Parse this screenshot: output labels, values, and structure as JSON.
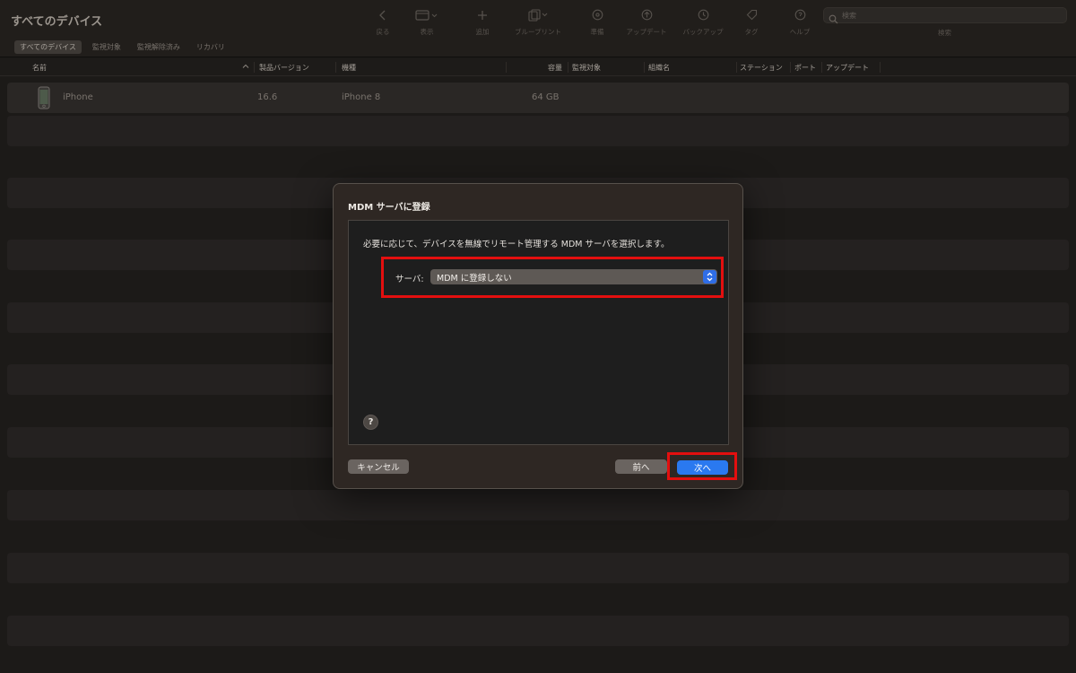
{
  "window": {
    "title": "すべてのデバイス"
  },
  "filter_tabs": [
    {
      "label": "すべてのデバイス",
      "active": true
    },
    {
      "label": "監視対象",
      "active": false
    },
    {
      "label": "監視解除済み",
      "active": false
    },
    {
      "label": "リカバリ",
      "active": false
    }
  ],
  "toolbar": {
    "buttons": [
      {
        "label": "戻る",
        "icon": "chevron-left-icon"
      },
      {
        "label": "表示",
        "icon": "view-icon"
      },
      {
        "label": "追加",
        "icon": "plus-icon"
      },
      {
        "label": "ブループリント",
        "icon": "blueprint-icon"
      },
      {
        "label": "準備",
        "icon": "prepare-icon"
      },
      {
        "label": "アップデート",
        "icon": "update-icon"
      },
      {
        "label": "バックアップ",
        "icon": "backup-icon"
      },
      {
        "label": "タグ",
        "icon": "tag-icon"
      },
      {
        "label": "ヘルプ",
        "icon": "help-icon"
      }
    ],
    "search": {
      "placeholder": "検索",
      "label": "検索"
    }
  },
  "table": {
    "columns": [
      "名前",
      "製品バージョン",
      "機種",
      "容量",
      "監視対象",
      "組織名",
      "ステーション",
      "ポート",
      "アップデート"
    ],
    "rows": [
      {
        "name": "iPhone",
        "version": "16.6",
        "model": "iPhone 8",
        "capacity": "64 GB"
      }
    ]
  },
  "dialog": {
    "title": "MDM サーバに登録",
    "description": "必要に応じて、デバイスを無線でリモート管理する MDM サーバを選択します。",
    "server_label": "サーバ:",
    "server_value": "MDM に登録しない",
    "help_label": "?",
    "cancel_label": "キャンセル",
    "back_label": "前へ",
    "next_label": "次へ"
  },
  "colors": {
    "accent": "#2a79f0",
    "highlight": "#e30f0f",
    "background": "#1c1a18"
  }
}
